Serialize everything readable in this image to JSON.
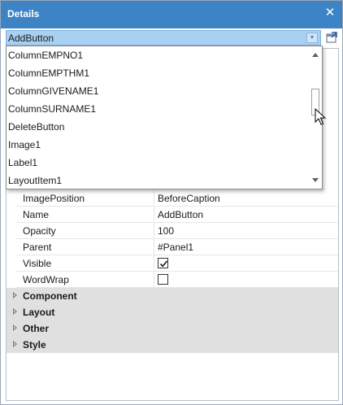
{
  "panel": {
    "title": "Details",
    "close_glyph": "✕"
  },
  "combo": {
    "selected": "AddButton",
    "arrow_glyph": "▼"
  },
  "dropdown": {
    "items": [
      "ColumnEMPNO1",
      "ColumnEMPTHM1",
      "ColumnGIVENAME1",
      "ColumnSURNAME1",
      "DeleteButton",
      "Image1",
      "Label1",
      "LayoutItem1"
    ],
    "scroll_position": 0.32
  },
  "properties": [
    {
      "name": "ImagePosition",
      "value": "BeforeCaption"
    },
    {
      "name": "Name",
      "value": "AddButton"
    },
    {
      "name": "Opacity",
      "value": "100"
    },
    {
      "name": "Parent",
      "value": "#Panel1"
    },
    {
      "name": "Visible",
      "value": "",
      "checked": true
    },
    {
      "name": "WordWrap",
      "value": "",
      "checked": false
    }
  ],
  "categories": [
    "Component",
    "Layout",
    "Other",
    "Style"
  ],
  "icons": {
    "close": "close-icon",
    "dropdown": "chevron-down-icon",
    "side": "popout-icon",
    "expand": "caret-right-icon",
    "check": "checkmark-icon",
    "cursor": "mouse-pointer-icon"
  },
  "colors": {
    "titlebar": "#3d84c6",
    "combo_selected": "#a8d0f0",
    "category_bg": "#e0e0e0"
  }
}
